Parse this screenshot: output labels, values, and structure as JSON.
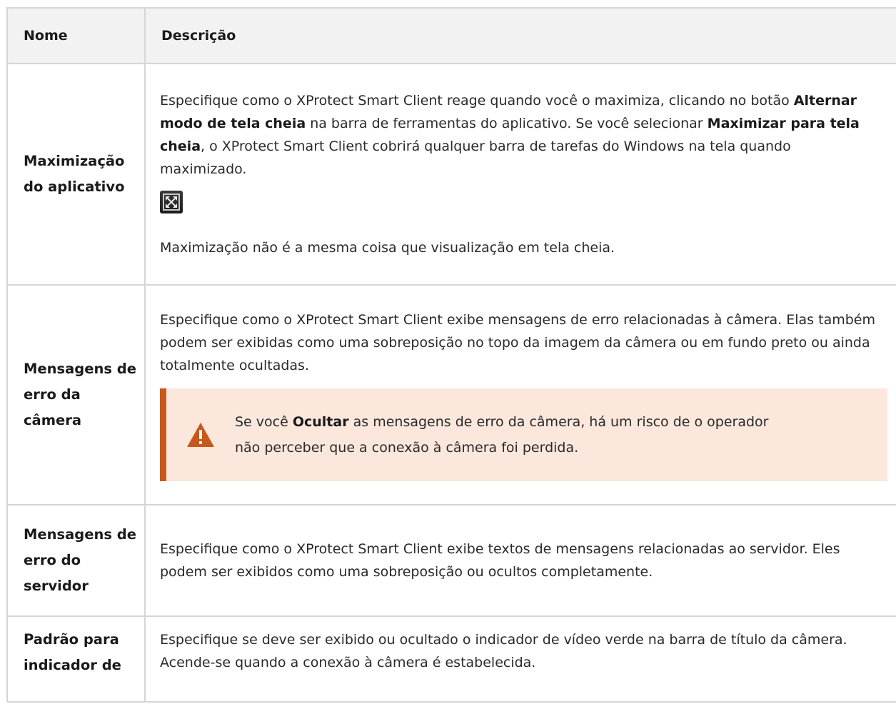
{
  "header": {
    "col_name": "Nome",
    "col_desc": "Descrição"
  },
  "rows": [
    {
      "name": "Maximização do aplicativo",
      "p1": "Especifique como o XProtect Smart Client reage quando você o maximiza, clicando no botão ",
      "b1": "Alternar modo de tela cheia",
      "p2": " na barra de ferramentas do aplicativo. Se você selecionar ",
      "b2": "Maximizar para tela cheia",
      "p3": ", o XProtect Smart Client cobrirá qualquer barra de tarefas do Windows na tela quando maximizado.",
      "icon": "fullscreen-toggle-icon",
      "note": "Maximização não é a mesma coisa que visualização em tela cheia."
    },
    {
      "name": "Mensagens de erro da câmera",
      "desc": "Especifique como o XProtect Smart Client exibe mensagens de erro relacionadas à câmera. Elas também podem ser exibidas como uma sobreposição no topo da imagem da câmera ou em fundo preto ou ainda totalmente ocultadas.",
      "warning_pre": "Se você ",
      "warning_bold": "Ocultar",
      "warning_post": " as mensagens de erro da câmera, há um risco de o operador não perceber que a conexão à câmera foi perdida.",
      "warning_icon": "warning-triangle-icon",
      "warning_color": "#c7581b"
    },
    {
      "name": "Mensagens de erro do servidor",
      "desc": "Especifique como o XProtect Smart Client exibe textos de mensagens relacionadas ao servidor. Eles podem ser exibidos como uma sobreposição ou ocultos completamente."
    },
    {
      "name": "Padrão para indicador de",
      "desc": "Especifique se deve ser exibido ou ocultado o indicador de vídeo verde na barra de título da câmera. Acende-se quando a conexão à câmera é estabelecida."
    }
  ]
}
